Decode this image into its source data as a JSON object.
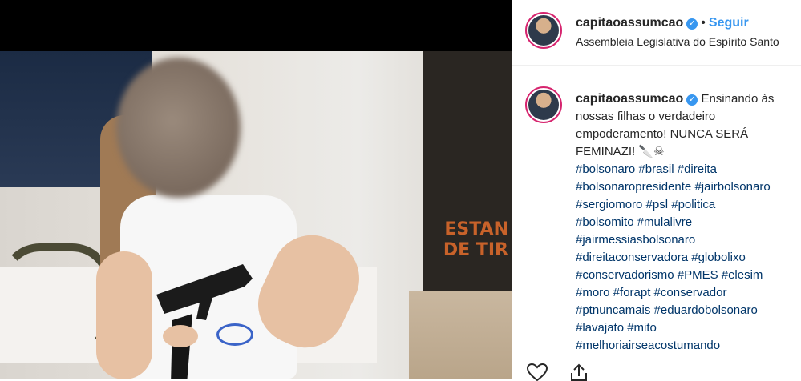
{
  "post": {
    "username": "capitaoassumcao",
    "separator": "•",
    "follow_label": "Seguir",
    "location": "Assembleia Legislativa do Espírito Santo"
  },
  "photo": {
    "sign_line1": "ESTAN",
    "sign_line2": "DE TIR"
  },
  "caption": {
    "username": "capitaoassumcao",
    "text": "Ensinando às nossas filhas o verdadeiro empoderamento! NUNCA SERÁ FEMINAZI! 🔪☠",
    "hashtags_1": "#bolsonaro #brasil #direita",
    "hashtags_2": "#bolsonaropresidente #jairbolsonaro",
    "hashtags_3": "#sergiomoro #psl #politica",
    "hashtags_4": "#bolsomito #mulalivre",
    "hashtags_5": "#jairmessiasbolsonaro",
    "hashtags_6": "#direitaconservadora #globolixo",
    "hashtags_7": "#conservadorismo #PMES #elesim",
    "hashtags_8": "#moro #forapt #conservador",
    "hashtags_9": "#ptnuncamais #eduardobolsonaro",
    "hashtags_10": "#lavajato #mito",
    "hashtags_11": "#melhoriairseacostumando"
  },
  "icons": {
    "verified": "verified-badge-icon",
    "like": "heart-icon",
    "share": "share-icon"
  },
  "colors": {
    "link": "#3897f0",
    "hashtag": "#003569",
    "story_ring": "#d6246e"
  }
}
